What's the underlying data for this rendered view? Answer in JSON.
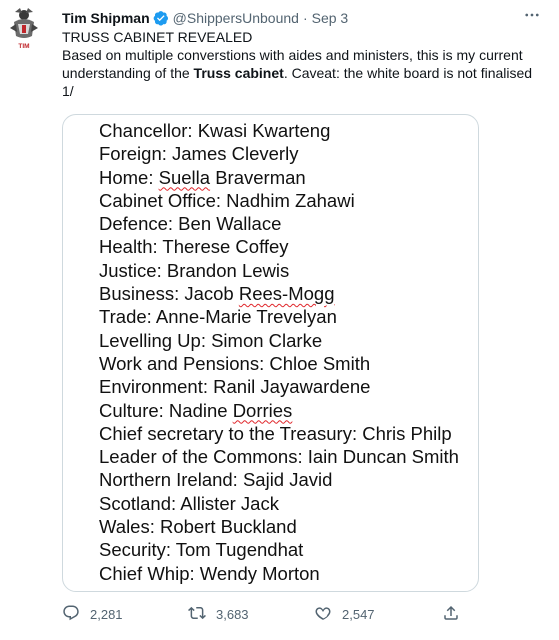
{
  "author": {
    "name": "Tim Shipman",
    "handle": "@ShippersUnbound",
    "separator": "·",
    "date": "Sep 3",
    "avatar_caption": "TIM"
  },
  "tweet": {
    "headline": "TRUSS CABINET REVEALED",
    "body_before_bold": "Based on multiple converstions with aides and ministers, this is my current understanding of the ",
    "body_bold": "Truss cabinet",
    "body_after_bold": ". Caveat: the white board is not finalised 1/"
  },
  "cabinet_list": [
    {
      "text": "Chancellor: Kwasi Kwarteng"
    },
    {
      "text": "Foreign: James Cleverly"
    },
    {
      "pre": "Home: ",
      "squiggle": "Suella",
      "post": " Braverman"
    },
    {
      "text": "Cabinet Office: Nadhim Zahawi"
    },
    {
      "text": "Defence: Ben Wallace"
    },
    {
      "text": "Health: Therese Coffey"
    },
    {
      "text": "Justice: Brandon Lewis"
    },
    {
      "pre": "Business: Jacob ",
      "squiggle": "Rees-Mogg",
      "post": ""
    },
    {
      "text": "Trade: Anne-Marie Trevelyan"
    },
    {
      "text": "Levelling Up: Simon Clarke"
    },
    {
      "text": "Work and Pensions: Chloe Smith"
    },
    {
      "text": "Environment: Ranil Jayawardene"
    },
    {
      "pre": "Culture: Nadine ",
      "squiggle": "Dorries",
      "post": ""
    },
    {
      "text": "Chief secretary to the Treasury: Chris Philp"
    },
    {
      "text": "Leader of the Commons: Iain Duncan Smith"
    },
    {
      "text": "Northern Ireland: Sajid Javid"
    },
    {
      "text": "Scotland: Allister Jack"
    },
    {
      "text": "Wales: Robert Buckland"
    },
    {
      "text": "Security: Tom Tugendhat"
    },
    {
      "text": "Chief Whip: Wendy Morton"
    }
  ],
  "actions": {
    "replies": "2,281",
    "retweets": "3,683",
    "likes": "2,547"
  },
  "icons": {
    "verified": "verified-badge-icon",
    "more": "more-options-icon",
    "reply": "reply-icon",
    "retweet": "retweet-icon",
    "like": "heart-icon",
    "share": "share-icon"
  },
  "colors": {
    "verified": "#1d9bf0",
    "muted": "#536471",
    "spell_underline": "#e0262b"
  }
}
